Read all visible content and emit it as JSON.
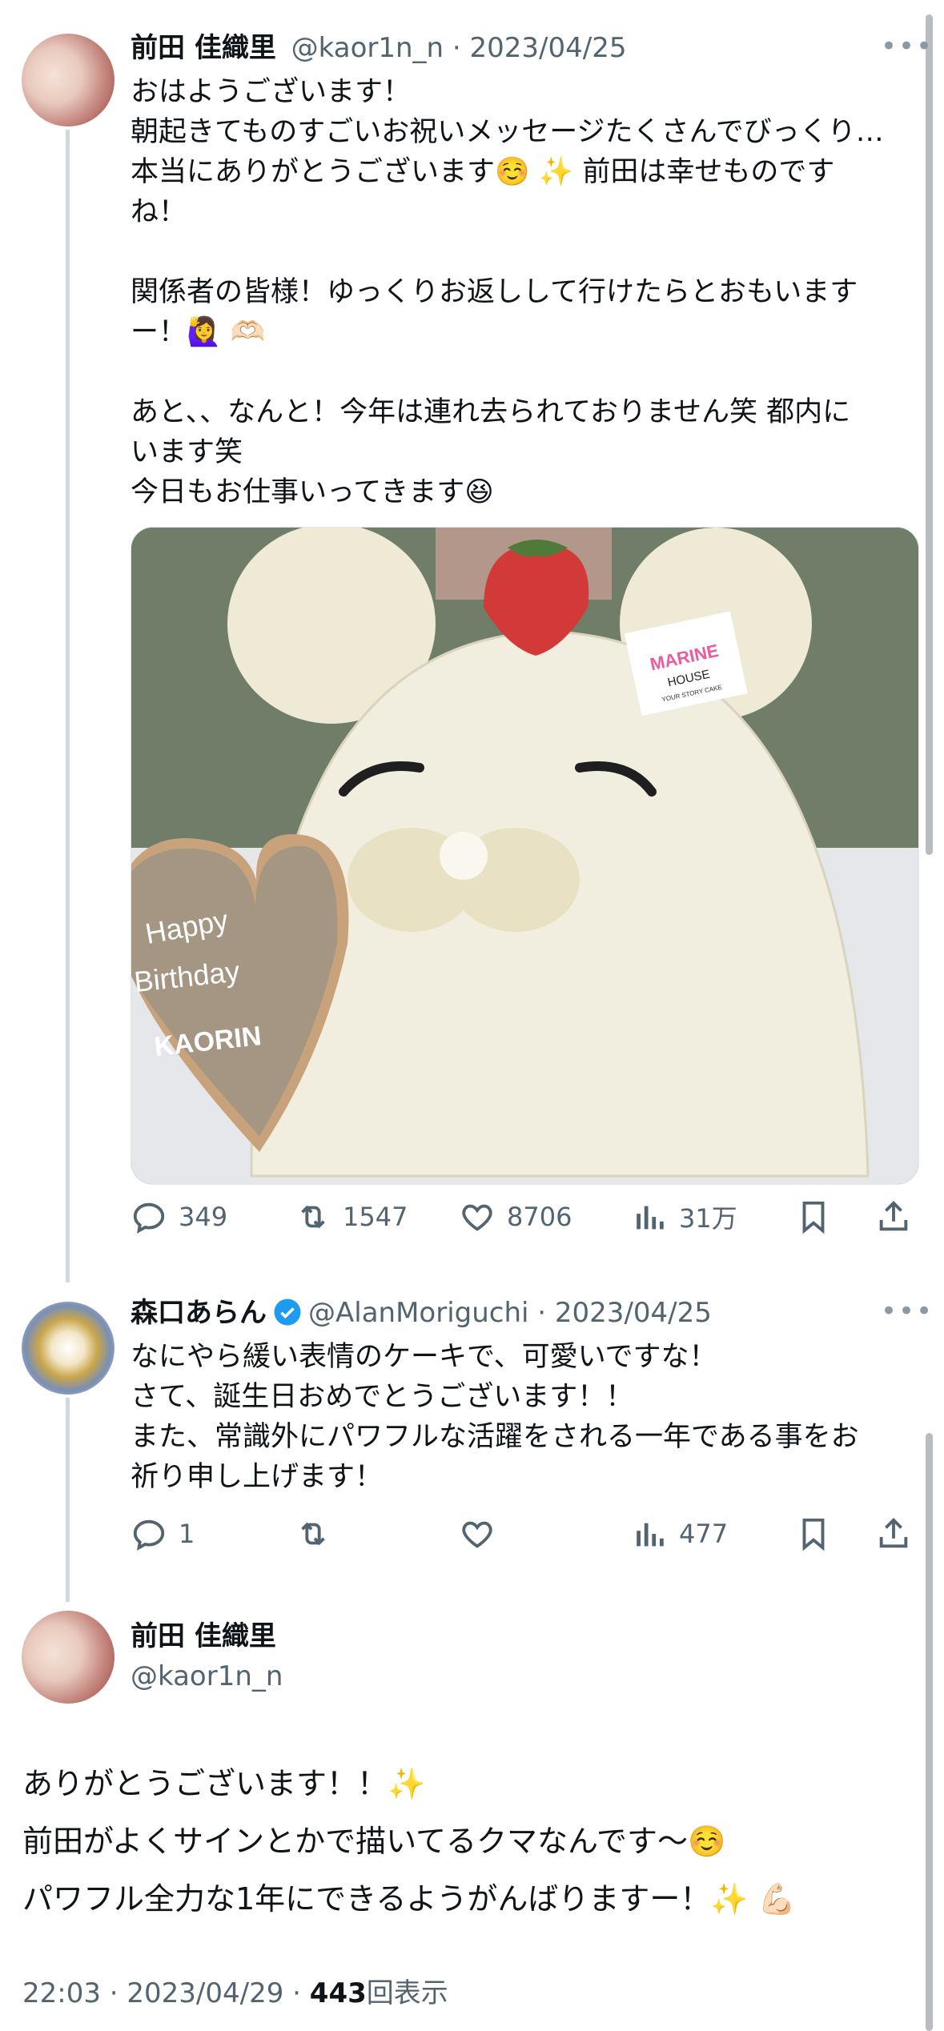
{
  "tweet1": {
    "name": "前田 佳織里",
    "handle": "@kaor1n_n",
    "date": "· 2023/04/25",
    "more": "•••",
    "text": "おはようございます！\n朝起きてものすごいお祝いメッセージたくさんでびっくり…\n本当にありがとうございます☺️ ✨ 前田は幸せものです\nね！\n\n関係者の皆様！ゆっくりお返しして行けたらとおもいます\nー！🙋‍♀️ 🫶🏻\n\nあと、、なんと！今年は連れ去られておりません笑 都内に\nいます笑\n今日もお仕事いってきます😆",
    "image": {
      "cookie_line1": "Happy",
      "cookie_line2": "Birthday",
      "cookie_line3": "KAORIN",
      "tag_line1": "MARINE",
      "tag_line2": "HOUSE",
      "tag_line3": "YOUR STORY CAKE"
    },
    "replies": "349",
    "retweets": "1547",
    "likes": "8706",
    "views": "31万"
  },
  "tweet2": {
    "name": "森口あらん",
    "handle": "@AlanMoriguchi",
    "date": "· 2023/04/25",
    "more": "•••",
    "text": "なにやら緩い表情のケーキで、可愛いですな！\nさて、誕生日おめでとうございます！！\nまた、常識外にパワフルな活躍をされる一年である事をお\n祈り申し上げます！",
    "replies": "1",
    "views": "477"
  },
  "tweet3": {
    "name": "前田 佳織里",
    "handle": "@kaor1n_n",
    "text": "ありがとうございます！！✨\n前田がよくサインとかで描いてるクマなんです〜☺️\nパワフル全力な1年にできるようがんばりますー！✨ 💪🏻",
    "time": "22:03 · 2023/04/29 · ",
    "views_count": "443",
    "views_label": "回表示"
  },
  "colors": {
    "text": "#0f1419",
    "secondary": "#536471",
    "thread_line": "#cfd9de",
    "verified": "#1d9bf0"
  }
}
